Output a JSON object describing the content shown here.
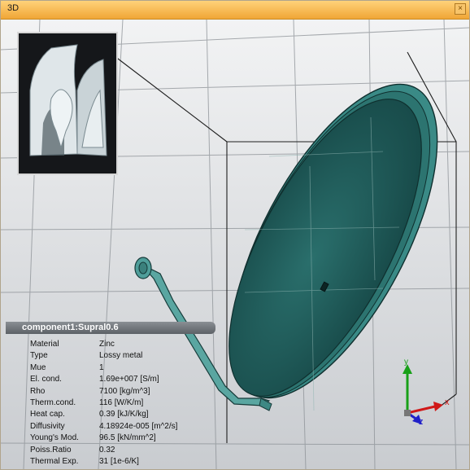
{
  "window": {
    "title": "3D",
    "close_glyph": "×"
  },
  "thumbnail": {
    "icon": "component-preview-thumbnail"
  },
  "properties_panel": {
    "title": "component1:Supral0.6",
    "rows": [
      {
        "label": "Material",
        "value": "Zinc"
      },
      {
        "label": "Type",
        "value": "Lossy metal"
      },
      {
        "label": "Mue",
        "value": "1"
      },
      {
        "label": "El. cond.",
        "value": "1.69e+007 [S/m]"
      },
      {
        "label": "Rho",
        "value": "7100 [kg/m^3]"
      },
      {
        "label": "Therm.cond.",
        "value": "116 [W/K/m]"
      },
      {
        "label": "Heat cap.",
        "value": "0.39 [kJ/K/kg]"
      },
      {
        "label": "Diffusivity",
        "value": "4.18924e-005 [m^2/s]"
      },
      {
        "label": "Young's Mod.",
        "value": "96.5 [kN/mm^2]"
      },
      {
        "label": "Poiss.Ratio",
        "value": "0.32"
      },
      {
        "label": "Thermal Exp.",
        "value": "31 [1e-6/K]"
      }
    ]
  },
  "axes": {
    "x_label": "x",
    "y_label": "y",
    "z_label": "z",
    "x_color": "#d01818",
    "y_color": "#18a018",
    "z_color": "#2020c8"
  },
  "colors": {
    "titlebar": "#f0a636",
    "dish": "#1f5b5a",
    "dish_rim": "#3a8a86",
    "arm": "#4f9e9a"
  }
}
